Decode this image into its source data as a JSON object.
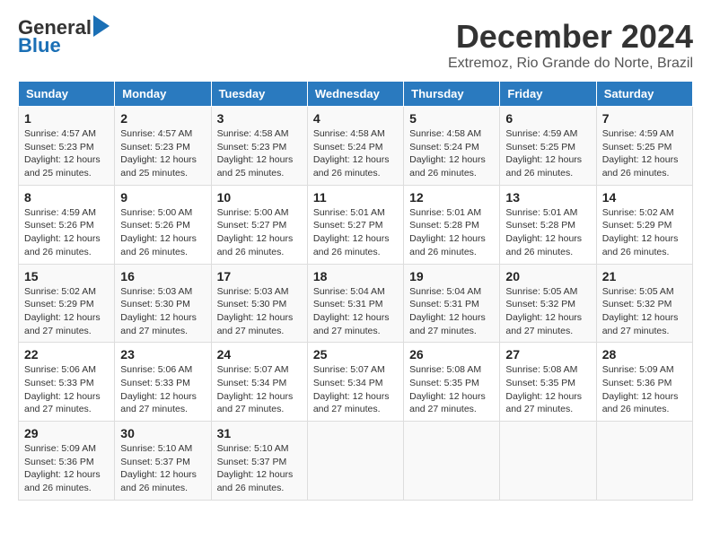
{
  "logo": {
    "line1": "General",
    "line2": "Blue"
  },
  "title": "December 2024",
  "subtitle": "Extremoz, Rio Grande do Norte, Brazil",
  "days_of_week": [
    "Sunday",
    "Monday",
    "Tuesday",
    "Wednesday",
    "Thursday",
    "Friday",
    "Saturday"
  ],
  "weeks": [
    [
      {
        "day": "1",
        "info": "Sunrise: 4:57 AM\nSunset: 5:23 PM\nDaylight: 12 hours\nand 25 minutes."
      },
      {
        "day": "2",
        "info": "Sunrise: 4:57 AM\nSunset: 5:23 PM\nDaylight: 12 hours\nand 25 minutes."
      },
      {
        "day": "3",
        "info": "Sunrise: 4:58 AM\nSunset: 5:23 PM\nDaylight: 12 hours\nand 25 minutes."
      },
      {
        "day": "4",
        "info": "Sunrise: 4:58 AM\nSunset: 5:24 PM\nDaylight: 12 hours\nand 26 minutes."
      },
      {
        "day": "5",
        "info": "Sunrise: 4:58 AM\nSunset: 5:24 PM\nDaylight: 12 hours\nand 26 minutes."
      },
      {
        "day": "6",
        "info": "Sunrise: 4:59 AM\nSunset: 5:25 PM\nDaylight: 12 hours\nand 26 minutes."
      },
      {
        "day": "7",
        "info": "Sunrise: 4:59 AM\nSunset: 5:25 PM\nDaylight: 12 hours\nand 26 minutes."
      }
    ],
    [
      {
        "day": "8",
        "info": "Sunrise: 4:59 AM\nSunset: 5:26 PM\nDaylight: 12 hours\nand 26 minutes."
      },
      {
        "day": "9",
        "info": "Sunrise: 5:00 AM\nSunset: 5:26 PM\nDaylight: 12 hours\nand 26 minutes."
      },
      {
        "day": "10",
        "info": "Sunrise: 5:00 AM\nSunset: 5:27 PM\nDaylight: 12 hours\nand 26 minutes."
      },
      {
        "day": "11",
        "info": "Sunrise: 5:01 AM\nSunset: 5:27 PM\nDaylight: 12 hours\nand 26 minutes."
      },
      {
        "day": "12",
        "info": "Sunrise: 5:01 AM\nSunset: 5:28 PM\nDaylight: 12 hours\nand 26 minutes."
      },
      {
        "day": "13",
        "info": "Sunrise: 5:01 AM\nSunset: 5:28 PM\nDaylight: 12 hours\nand 26 minutes."
      },
      {
        "day": "14",
        "info": "Sunrise: 5:02 AM\nSunset: 5:29 PM\nDaylight: 12 hours\nand 26 minutes."
      }
    ],
    [
      {
        "day": "15",
        "info": "Sunrise: 5:02 AM\nSunset: 5:29 PM\nDaylight: 12 hours\nand 27 minutes."
      },
      {
        "day": "16",
        "info": "Sunrise: 5:03 AM\nSunset: 5:30 PM\nDaylight: 12 hours\nand 27 minutes."
      },
      {
        "day": "17",
        "info": "Sunrise: 5:03 AM\nSunset: 5:30 PM\nDaylight: 12 hours\nand 27 minutes."
      },
      {
        "day": "18",
        "info": "Sunrise: 5:04 AM\nSunset: 5:31 PM\nDaylight: 12 hours\nand 27 minutes."
      },
      {
        "day": "19",
        "info": "Sunrise: 5:04 AM\nSunset: 5:31 PM\nDaylight: 12 hours\nand 27 minutes."
      },
      {
        "day": "20",
        "info": "Sunrise: 5:05 AM\nSunset: 5:32 PM\nDaylight: 12 hours\nand 27 minutes."
      },
      {
        "day": "21",
        "info": "Sunrise: 5:05 AM\nSunset: 5:32 PM\nDaylight: 12 hours\nand 27 minutes."
      }
    ],
    [
      {
        "day": "22",
        "info": "Sunrise: 5:06 AM\nSunset: 5:33 PM\nDaylight: 12 hours\nand 27 minutes."
      },
      {
        "day": "23",
        "info": "Sunrise: 5:06 AM\nSunset: 5:33 PM\nDaylight: 12 hours\nand 27 minutes."
      },
      {
        "day": "24",
        "info": "Sunrise: 5:07 AM\nSunset: 5:34 PM\nDaylight: 12 hours\nand 27 minutes."
      },
      {
        "day": "25",
        "info": "Sunrise: 5:07 AM\nSunset: 5:34 PM\nDaylight: 12 hours\nand 27 minutes."
      },
      {
        "day": "26",
        "info": "Sunrise: 5:08 AM\nSunset: 5:35 PM\nDaylight: 12 hours\nand 27 minutes."
      },
      {
        "day": "27",
        "info": "Sunrise: 5:08 AM\nSunset: 5:35 PM\nDaylight: 12 hours\nand 27 minutes."
      },
      {
        "day": "28",
        "info": "Sunrise: 5:09 AM\nSunset: 5:36 PM\nDaylight: 12 hours\nand 26 minutes."
      }
    ],
    [
      {
        "day": "29",
        "info": "Sunrise: 5:09 AM\nSunset: 5:36 PM\nDaylight: 12 hours\nand 26 minutes."
      },
      {
        "day": "30",
        "info": "Sunrise: 5:10 AM\nSunset: 5:37 PM\nDaylight: 12 hours\nand 26 minutes."
      },
      {
        "day": "31",
        "info": "Sunrise: 5:10 AM\nSunset: 5:37 PM\nDaylight: 12 hours\nand 26 minutes."
      },
      {
        "day": "",
        "info": ""
      },
      {
        "day": "",
        "info": ""
      },
      {
        "day": "",
        "info": ""
      },
      {
        "day": "",
        "info": ""
      }
    ]
  ]
}
